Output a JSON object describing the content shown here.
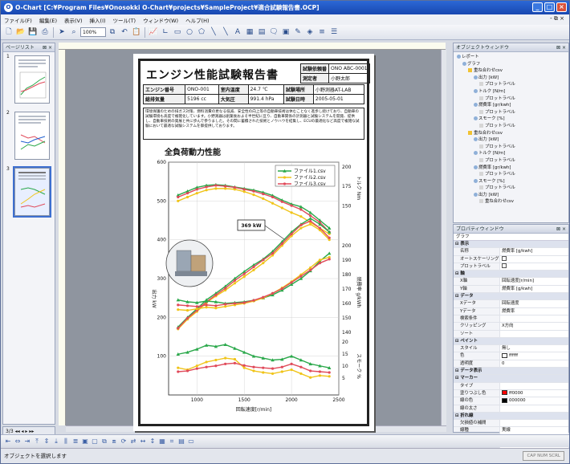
{
  "window": {
    "title": "O-Chart [C:¥Program Files¥Onosokki O-Chart¥projects¥SampleProject¥適合試験報告書.OCP]",
    "app_icon": "O",
    "min": "_",
    "max": "□",
    "close": "×"
  },
  "menu": [
    "ファイル(F)",
    "編集(E)",
    "表示(V)",
    "挿入(I)",
    "ツール(T)",
    "ウィンドウ(W)",
    "ヘルプ(H)"
  ],
  "menu_right": "- ⧉ ×",
  "toolbar": {
    "zoom": "100%"
  },
  "pagelist": {
    "title": "ページリスト",
    "pages": [
      "1",
      "2",
      "3"
    ],
    "nav": "3/3"
  },
  "report": {
    "title": "エンジン性能試験報告書",
    "rows_right": [
      [
        "試験依頼番",
        "ONO ABC-0001"
      ],
      [
        "測定者",
        "小野太郎"
      ]
    ],
    "rows_mid": [
      [
        "エンジン番号",
        "ONO-001",
        "室内温度",
        "24.7 ℃",
        "試験場所",
        "小野測器AT-LAB"
      ],
      [
        "総排気量",
        "5196 cc",
        "大気圧",
        "991.4 hPa",
        "試験日時",
        "2005-05-01"
      ]
    ],
    "description": "環境保護のための排ガス対策、燃料消費の更なる低減、安全性の向上等の自動車技術は休むことなく進歩し続けており、自動車の試験環境も高度で複雑化しています。小野測器は創業後およそ半世紀に亘り、自動車関係の計測器と試験システムを開発、提供し、自動車技術の発展と共に歩んで参りました。その間に蓄積された技術とノウハウを結集し、ECUの最適化など高度で複雑な試験において最適な試験システムを御提供しております。",
    "chart_title": "全負荷動力性能"
  },
  "chart_data": {
    "type": "line",
    "title": "全負荷動力性能",
    "xlabel": "回転速度[r/min]",
    "xlim": [
      700,
      2500
    ],
    "xticks": [
      1000,
      1500,
      2000,
      2500
    ],
    "left_axis": {
      "label": "出力 kW",
      "lim": [
        0,
        600
      ],
      "ticks": [
        100,
        200,
        300,
        400,
        500,
        600
      ]
    },
    "right_axis_top": {
      "label": "トルク Nm",
      "lim": [
        140,
        200
      ],
      "ticks": [
        150,
        175,
        200
      ]
    },
    "right_axis_mid": {
      "label": "燃費率 g/kWh",
      "lim": [
        140,
        200
      ],
      "ticks": [
        140,
        150,
        160,
        170,
        180,
        190,
        200
      ]
    },
    "right_axis_bot": {
      "label": "スモーク %",
      "lim": [
        0,
        20
      ],
      "ticks": [
        5,
        10,
        15,
        20
      ]
    },
    "legend": [
      "ファイル1.csv",
      "ファイル2.csv",
      "ファイル3.csv"
    ],
    "legend_position": "top-right",
    "annotation": "369 kW",
    "colors": [
      "#2aa84a",
      "#f0c419",
      "#e04a5a"
    ],
    "x": [
      800,
      900,
      1000,
      1100,
      1200,
      1300,
      1400,
      1500,
      1600,
      1700,
      1800,
      1900,
      2000,
      2100,
      2200,
      2300,
      2400
    ],
    "series_torque": [
      [
        515,
        525,
        535,
        540,
        542,
        540,
        536,
        532,
        528,
        522,
        514,
        502,
        492,
        485,
        470,
        450,
        430
      ],
      [
        500,
        510,
        520,
        528,
        532,
        532,
        530,
        524,
        516,
        506,
        494,
        482,
        470,
        460,
        445,
        430,
        415
      ],
      [
        510,
        520,
        530,
        536,
        540,
        538,
        535,
        530,
        525,
        518,
        510,
        498,
        488,
        478,
        462,
        445,
        420
      ]
    ],
    "series_power": [
      [
        175,
        200,
        222,
        245,
        262,
        280,
        300,
        318,
        335,
        350,
        370,
        395,
        420,
        440,
        455,
        440,
        420
      ],
      [
        170,
        195,
        215,
        238,
        255,
        270,
        288,
        305,
        322,
        340,
        360,
        385,
        410,
        430,
        440,
        425,
        400
      ],
      [
        172,
        198,
        218,
        240,
        258,
        275,
        295,
        312,
        330,
        348,
        365,
        390,
        415,
        438,
        448,
        430,
        405
      ]
    ],
    "series_bsfc": [
      [
        245,
        240,
        238,
        242,
        240,
        236,
        238,
        240,
        244,
        250,
        258,
        270,
        285,
        300,
        320,
        345,
        365
      ],
      [
        220,
        218,
        222,
        226,
        224,
        228,
        232,
        236,
        242,
        250,
        262,
        276,
        292,
        310,
        328,
        348,
        355
      ],
      [
        232,
        230,
        228,
        232,
        230,
        234,
        236,
        238,
        244,
        252,
        262,
        274,
        290,
        306,
        322,
        340,
        350
      ]
    ],
    "series_smoke": [
      [
        105,
        110,
        118,
        128,
        125,
        130,
        120,
        110,
        100,
        95,
        90,
        92,
        100,
        90,
        80,
        75,
        70
      ],
      [
        70,
        65,
        75,
        85,
        90,
        95,
        92,
        70,
        62,
        58,
        55,
        60,
        65,
        55,
        45,
        50,
        48
      ],
      [
        60,
        62,
        68,
        72,
        75,
        80,
        82,
        76,
        72,
        70,
        68,
        72,
        80,
        72,
        62,
        60,
        58
      ]
    ]
  },
  "objwin": {
    "title": "オブジェクトウィンドウ",
    "tree": [
      [
        0,
        "ic",
        "レポート"
      ],
      [
        1,
        "ic",
        "グラフ"
      ],
      [
        2,
        "fi",
        "重ね合わせcsv"
      ],
      [
        3,
        "ic",
        "出力 [kW]"
      ],
      [
        4,
        "ic2",
        "プロットラベル"
      ],
      [
        3,
        "ic",
        "トルク [N/m]"
      ],
      [
        4,
        "ic2",
        "プロットラベル"
      ],
      [
        3,
        "ic",
        "燃費率 [gr/kwh]"
      ],
      [
        4,
        "ic2",
        "プロットラベル"
      ],
      [
        3,
        "ic",
        "スモーク [%]"
      ],
      [
        4,
        "ic2",
        "プロットラベル"
      ],
      [
        2,
        "fi",
        "重ね合わせcsv"
      ],
      [
        3,
        "ic",
        "出力 [kW]"
      ],
      [
        4,
        "ic2",
        "プロットラベル"
      ],
      [
        3,
        "ic",
        "トルク [N/m]"
      ],
      [
        4,
        "ic2",
        "プロットラベル"
      ],
      [
        3,
        "ic",
        "燃費率 [gr/kwh]"
      ],
      [
        4,
        "ic2",
        "プロットラベル"
      ],
      [
        3,
        "ic",
        "スモーク [%]"
      ],
      [
        4,
        "ic2",
        "プロットラベル"
      ],
      [
        3,
        "ic",
        "出力 [kW]"
      ],
      [
        4,
        "ic2",
        "重ね合わせcsv"
      ]
    ]
  },
  "propwin": {
    "title": "プロパティウィンドウ",
    "object": "グラフ",
    "rows": [
      [
        "cat",
        "表示",
        ""
      ],
      [
        "kv",
        "名称",
        "燃費率 [g/kwh]"
      ],
      [
        "kc",
        "オートスケーリング",
        ""
      ],
      [
        "kc",
        "プロットラベル",
        ""
      ],
      [
        "cat",
        "軸",
        ""
      ],
      [
        "kv",
        "X軸",
        "回転速度[r/min]"
      ],
      [
        "kv",
        "Y軸",
        "燃費率 [g/kwh]"
      ],
      [
        "cat",
        "データ",
        ""
      ],
      [
        "kv",
        "Xデータ",
        "回転速度"
      ],
      [
        "kv",
        "Yデータ",
        "燃費率"
      ],
      [
        "kv",
        "検索条件",
        ""
      ],
      [
        "kv",
        "クリッピング",
        "X方向"
      ],
      [
        "kv",
        "ソート",
        ""
      ],
      [
        "cat",
        "ペイント",
        ""
      ],
      [
        "kv",
        "スタイル",
        "無し"
      ],
      [
        "ks",
        "色",
        "#ffffff",
        "ffffff"
      ],
      [
        "kv",
        "透明度",
        "0"
      ],
      [
        "cat",
        "データ表示",
        ""
      ],
      [
        "cat",
        "マーカー",
        ""
      ],
      [
        "kv",
        "タイプ",
        ""
      ],
      [
        "ks",
        "塗りつぶし色",
        "#ff0000",
        "ff0000"
      ],
      [
        "ks",
        "線の色",
        "#000000",
        "000000"
      ],
      [
        "kv",
        "線の太さ",
        ""
      ],
      [
        "cat",
        "折れ線",
        ""
      ],
      [
        "kv",
        "欠損値の補間",
        ""
      ],
      [
        "kv",
        "線種",
        "実線"
      ],
      [
        "ks",
        "線の色",
        "#ff0000",
        "ff0000"
      ],
      [
        "kv",
        "線の太さ",
        "1"
      ],
      [
        "kv",
        "表種類",
        ""
      ]
    ]
  },
  "status": {
    "text": "オブジェクトを選択します",
    "indicator": "CAP NUM SCRL"
  }
}
